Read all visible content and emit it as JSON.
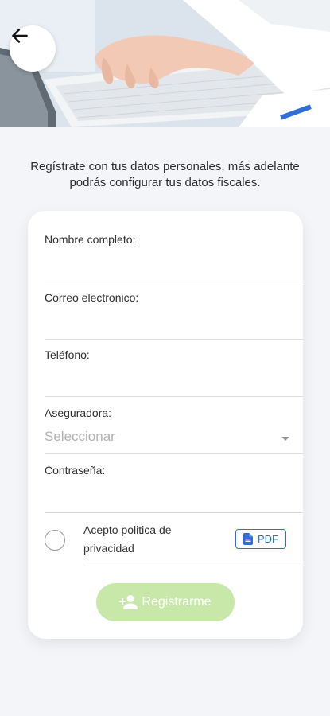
{
  "header": {
    "back_icon": "arrow-left-icon",
    "hero_image": "hands-typing-on-laptop"
  },
  "intro": {
    "text": "Regístrate con tus datos personales, más adelante podrás configurar tus datos fiscales."
  },
  "form": {
    "full_name": {
      "label": "Nombre completo:",
      "value": ""
    },
    "email": {
      "label": "Correo electronico:",
      "value": ""
    },
    "phone": {
      "label": "Teléfono:",
      "value": ""
    },
    "insurer": {
      "label": "Aseguradora:",
      "selected": "Seleccionar",
      "icon": "chevron-down-icon"
    },
    "password": {
      "label": "Contraseña:",
      "value": ""
    },
    "policy": {
      "checked": false,
      "text": "Acepto politica de privacidad",
      "pdf_label": "PDF",
      "pdf_icon": "pdf-file-icon"
    },
    "submit": {
      "label": "Registrarme",
      "icon": "add-user-icon",
      "color": "#c8e8aa",
      "enabled": false
    }
  },
  "colors": {
    "background": "#f4f5f9",
    "card": "#ffffff",
    "accent_blue": "#2f6fd6",
    "button_disabled": "#c8e8aa"
  }
}
